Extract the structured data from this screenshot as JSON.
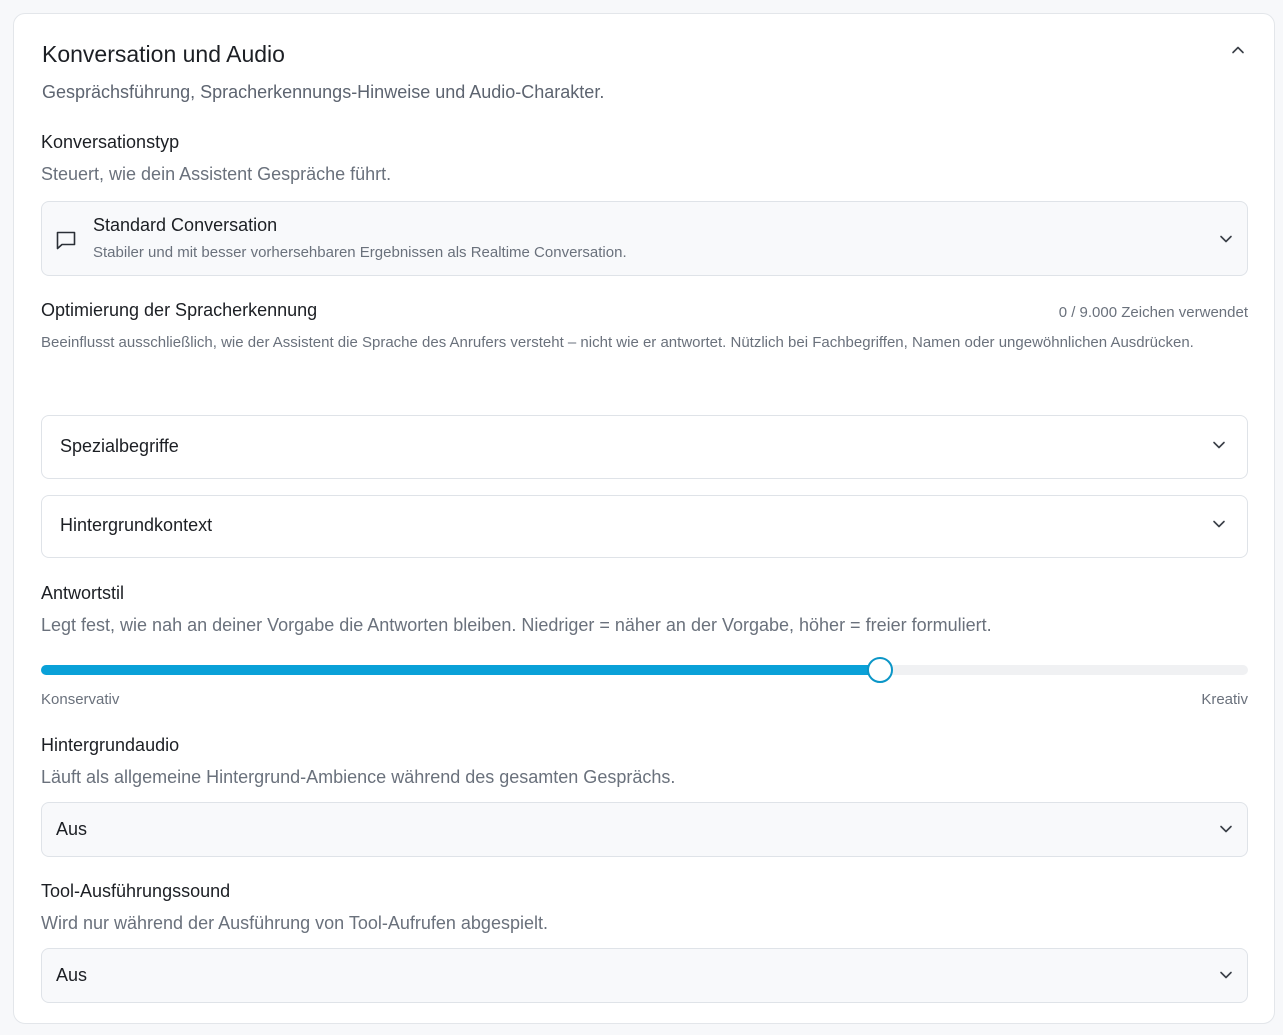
{
  "section": {
    "title": "Konversation und Audio",
    "subtitle": "Gesprächsführung, Spracherkennungs-Hinweise und Audio-Charakter."
  },
  "conversation_type": {
    "label": "Konversationstyp",
    "description": "Steuert, wie dein Assistent Gespräche führt.",
    "selected_title": "Standard Conversation",
    "selected_subtitle": "Stabiler und mit besser vorhersehbaren Ergebnissen als Realtime Conversation.",
    "icon": "chat-bubble-icon"
  },
  "speech_recognition": {
    "label": "Optimierung der Spracherkennung",
    "counter": "0 / 9.000 Zeichen verwendet",
    "description": "Beeinflusst ausschließlich, wie der Assistent die Sprache des Anrufers versteht – nicht wie er antwortet. Nützlich bei Fachbegriffen, Namen oder ungewöhnlichen Ausdrücken.",
    "special_terms_label": "Spezialbegriffe",
    "background_context_label": "Hintergrundkontext"
  },
  "response_style": {
    "label": "Antwortstil",
    "description": "Legt fest, wie nah an deiner Vorgabe die Antworten bleiben. Niedriger = näher an der Vorgabe, höher = freier formuliert.",
    "min_label": "Konservativ",
    "max_label": "Kreativ",
    "value_fraction": 0.695,
    "accent_color": "#0aa1d8"
  },
  "background_audio": {
    "label": "Hintergrundaudio",
    "description": "Läuft als allgemeine Hintergrund-Ambience während des gesamten Gesprächs.",
    "selected": "Aus"
  },
  "tool_sound": {
    "label": "Tool-Ausführungssound",
    "description": "Wird nur während der Ausführung von Tool-Aufrufen abgespielt.",
    "selected": "Aus"
  }
}
